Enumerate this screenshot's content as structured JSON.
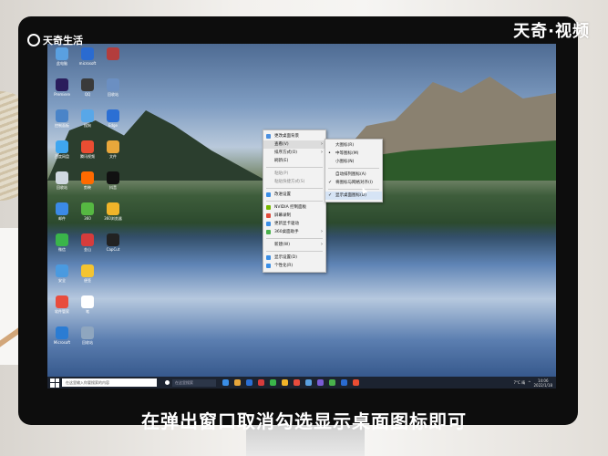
{
  "overlay": {
    "logo_text": "天奇生活",
    "watermark": "天奇·视频",
    "caption": "在弹出窗口取消勾选显示桌面图标即可"
  },
  "desktop_icons": [
    {
      "label": "此电脑",
      "color": "#5aa0e0"
    },
    {
      "label": "microsoft",
      "color": "#2a6bd1"
    },
    {
      "label": "",
      "color": "#b33d3d"
    },
    {
      "label": "Premiere",
      "color": "#2a1d5c"
    },
    {
      "label": "QQ",
      "color": "#3a3a3a"
    },
    {
      "label": "回收站",
      "color": "#6b8fc2"
    },
    {
      "label": "控制面板",
      "color": "#4a84c8"
    },
    {
      "label": "搜狗",
      "color": "#58a7e8"
    },
    {
      "label": "Edge",
      "color": "#2b6fd4"
    },
    {
      "label": "百度网盘",
      "color": "#3fa6f0"
    },
    {
      "label": "腾讯视频",
      "color": "#ea4d32"
    },
    {
      "label": "文件",
      "color": "#e8a73b"
    },
    {
      "label": "回收站",
      "color": "#d0d8e0"
    },
    {
      "label": "剪映",
      "color": "#ff6a00"
    },
    {
      "label": "抖音",
      "color": "#111111"
    },
    {
      "label": "邮件",
      "color": "#3b8ae6"
    },
    {
      "label": "360",
      "color": "#56b842"
    },
    {
      "label": "360浏览器",
      "color": "#f0b429"
    },
    {
      "label": "微信",
      "color": "#3ab54a"
    },
    {
      "label": "金山",
      "color": "#d63c3c"
    },
    {
      "label": "CapCut",
      "color": "#222222"
    },
    {
      "label": "安全",
      "color": "#4a9ae0"
    },
    {
      "label": "便签",
      "color": "#f4c430"
    },
    {
      "label": "",
      "color": "#00000000"
    },
    {
      "label": "软件管家",
      "color": "#e84c3d"
    },
    {
      "label": "笔",
      "color": "#ffffff"
    },
    {
      "label": "",
      "color": "#00000000"
    },
    {
      "label": "Microsoft",
      "color": "#2b7cd3"
    },
    {
      "label": "回收站",
      "color": "#8fa6bf"
    }
  ],
  "context_menu": {
    "items": [
      {
        "label": "更改桌面背景",
        "disabled": false,
        "icon": "#4a8fe0",
        "arrow": false
      },
      {
        "label": "查看(V)",
        "disabled": false,
        "icon": "",
        "arrow": true,
        "highlight": true
      },
      {
        "label": "排序方式(O)",
        "disabled": false,
        "icon": "",
        "arrow": true
      },
      {
        "label": "刷新(E)",
        "disabled": false,
        "icon": "",
        "arrow": false
      },
      {
        "sep": true
      },
      {
        "label": "粘贴(P)",
        "disabled": true,
        "icon": "",
        "arrow": false
      },
      {
        "label": "粘贴快捷方式(S)",
        "disabled": true,
        "icon": "",
        "arrow": false
      },
      {
        "sep": true
      },
      {
        "label": "改进设置",
        "disabled": false,
        "icon": "#3a8ee6",
        "arrow": false
      },
      {
        "sep": true
      },
      {
        "label": "NVIDIA 控制面板",
        "disabled": false,
        "icon": "#76b900",
        "arrow": false
      },
      {
        "label": "屏幕录制",
        "disabled": false,
        "icon": "#e04a3a",
        "arrow": false
      },
      {
        "label": "更新显卡驱动",
        "disabled": false,
        "icon": "#3a8ee6",
        "arrow": false,
        "shortcut": ""
      },
      {
        "label": "360桌面助手",
        "disabled": false,
        "icon": "#49b14c",
        "arrow": true
      },
      {
        "sep": true
      },
      {
        "label": "新建(W)",
        "disabled": false,
        "icon": "",
        "arrow": true
      },
      {
        "sep": true
      },
      {
        "label": "显示设置(D)",
        "disabled": false,
        "icon": "#3a8ee6",
        "arrow": false
      },
      {
        "label": "个性化(R)",
        "disabled": false,
        "icon": "#3a8ee6",
        "arrow": false
      }
    ]
  },
  "submenu": {
    "items": [
      {
        "label": "大图标(R)",
        "mark": ""
      },
      {
        "label": "中等图标(M)",
        "mark": "•"
      },
      {
        "label": "小图标(N)",
        "mark": ""
      },
      {
        "sep": true
      },
      {
        "label": "自动排列图标(A)",
        "mark": ""
      },
      {
        "label": "将图标与网格对齐(I)",
        "mark": "✓"
      },
      {
        "sep": true
      },
      {
        "label": "显示桌面图标(D)",
        "mark": "✓",
        "highlight": true
      }
    ]
  },
  "taskbar": {
    "search_placeholder": "在这里输入你要搜索的内容",
    "search2_placeholder": "在这里搜索",
    "apps": [
      "#3a8ee6",
      "#e8a73b",
      "#2b6fd4",
      "#d63c3c",
      "#3ab54a",
      "#f0b429",
      "#e84c3d",
      "#5aa0e0",
      "#7a5cd6",
      "#49b14c",
      "#2a6bd1",
      "#ea4d32"
    ],
    "weather": "7°C 晴",
    "time": "14:06",
    "date": "2022/1/18"
  }
}
